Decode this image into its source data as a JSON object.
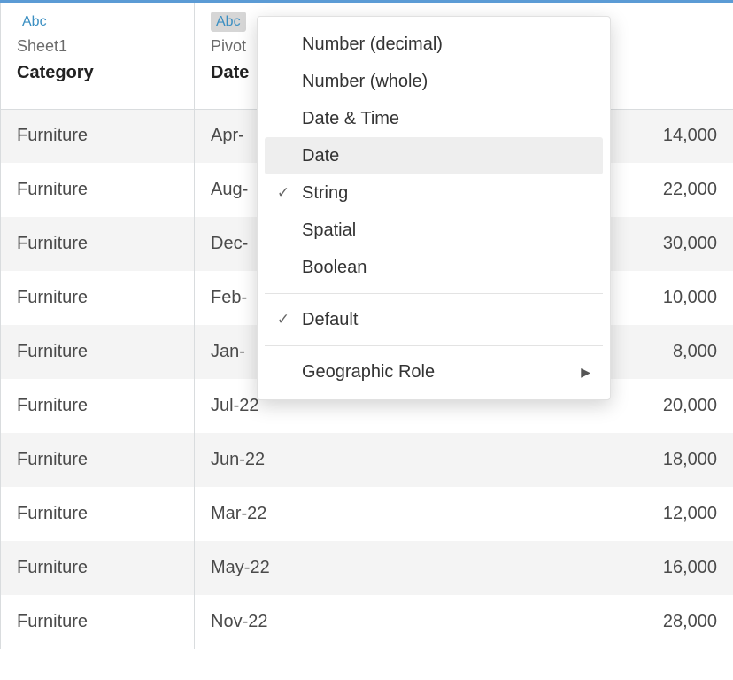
{
  "columns": [
    {
      "type_label": "Abc",
      "source": "Sheet1",
      "field": "Category",
      "active": false
    },
    {
      "type_label": "Abc",
      "source": "Pivot",
      "field": "Date",
      "active": true
    },
    {
      "type_label": "",
      "source": "",
      "field": "",
      "active": false
    }
  ],
  "rows": [
    {
      "category": "Furniture",
      "date": "Apr-",
      "value": "14,000"
    },
    {
      "category": "Furniture",
      "date": "Aug-",
      "value": "22,000"
    },
    {
      "category": "Furniture",
      "date": "Dec-",
      "value": "30,000"
    },
    {
      "category": "Furniture",
      "date": "Feb-",
      "value": "10,000"
    },
    {
      "category": "Furniture",
      "date": "Jan-",
      "value": "8,000"
    },
    {
      "category": "Furniture",
      "date": "Jul-22",
      "value": "20,000"
    },
    {
      "category": "Furniture",
      "date": "Jun-22",
      "value": "18,000"
    },
    {
      "category": "Furniture",
      "date": "Mar-22",
      "value": "12,000"
    },
    {
      "category": "Furniture",
      "date": "May-22",
      "value": "16,000"
    },
    {
      "category": "Furniture",
      "date": "Nov-22",
      "value": "28,000"
    }
  ],
  "menu": {
    "groups": [
      [
        {
          "label": "Number (decimal)",
          "checked": false,
          "highlight": false,
          "submenu": false
        },
        {
          "label": "Number (whole)",
          "checked": false,
          "highlight": false,
          "submenu": false
        },
        {
          "label": "Date & Time",
          "checked": false,
          "highlight": false,
          "submenu": false
        },
        {
          "label": "Date",
          "checked": false,
          "highlight": true,
          "submenu": false
        },
        {
          "label": "String",
          "checked": true,
          "highlight": false,
          "submenu": false
        },
        {
          "label": "Spatial",
          "checked": false,
          "highlight": false,
          "submenu": false
        },
        {
          "label": "Boolean",
          "checked": false,
          "highlight": false,
          "submenu": false
        }
      ],
      [
        {
          "label": "Default",
          "checked": true,
          "highlight": false,
          "submenu": false
        }
      ],
      [
        {
          "label": "Geographic Role",
          "checked": false,
          "highlight": false,
          "submenu": true
        }
      ]
    ]
  }
}
